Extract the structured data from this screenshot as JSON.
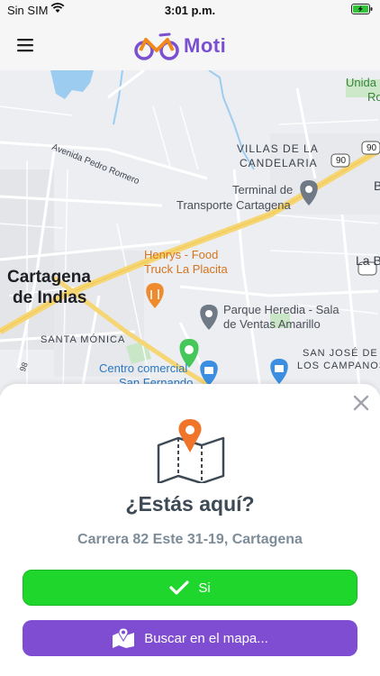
{
  "status_bar": {
    "carrier": "Sin SIM",
    "time": "3:01 p.m."
  },
  "header": {
    "logo_text": "Moti",
    "brand_color": "#7a4fd0"
  },
  "map": {
    "labels": {
      "villas": "VILLAS DE LA",
      "candelaria": "CANDELARIA",
      "unida": "Unida",
      "ro": "Ro",
      "terminal_1": "Terminal de",
      "terminal_2": "Transporte Cartagena",
      "avenida": "Avenida Pedro Romero",
      "henrys_1": "Henrys - Food",
      "henrys_2": "Truck La Placita",
      "cartagena_1": "Cartagena",
      "cartagena_2": "de Indias",
      "parque_1": "Parque Heredia - Sala",
      "parque_2": "de Ventas Amarillo",
      "santa_monica": "SANTA MÓNICA",
      "san_jose_1": "SAN JOSÉ DE",
      "san_jose_2": "LOS CAMPANOS",
      "centro_1": "Centro comercial",
      "centro_2": "San Fernando",
      "road_90a": "90",
      "road_90b": "90",
      "la_b": "La B",
      "b_edge": "B",
      "road_98": "98"
    }
  },
  "sheet": {
    "question": "¿Estás aquí?",
    "address": "Carrera 82 Este 31-19, Cartagena",
    "yes_label": "Si",
    "search_label": "Buscar en el mapa...",
    "yes_color": "#1fd62c",
    "search_color": "#7f4dd2"
  }
}
